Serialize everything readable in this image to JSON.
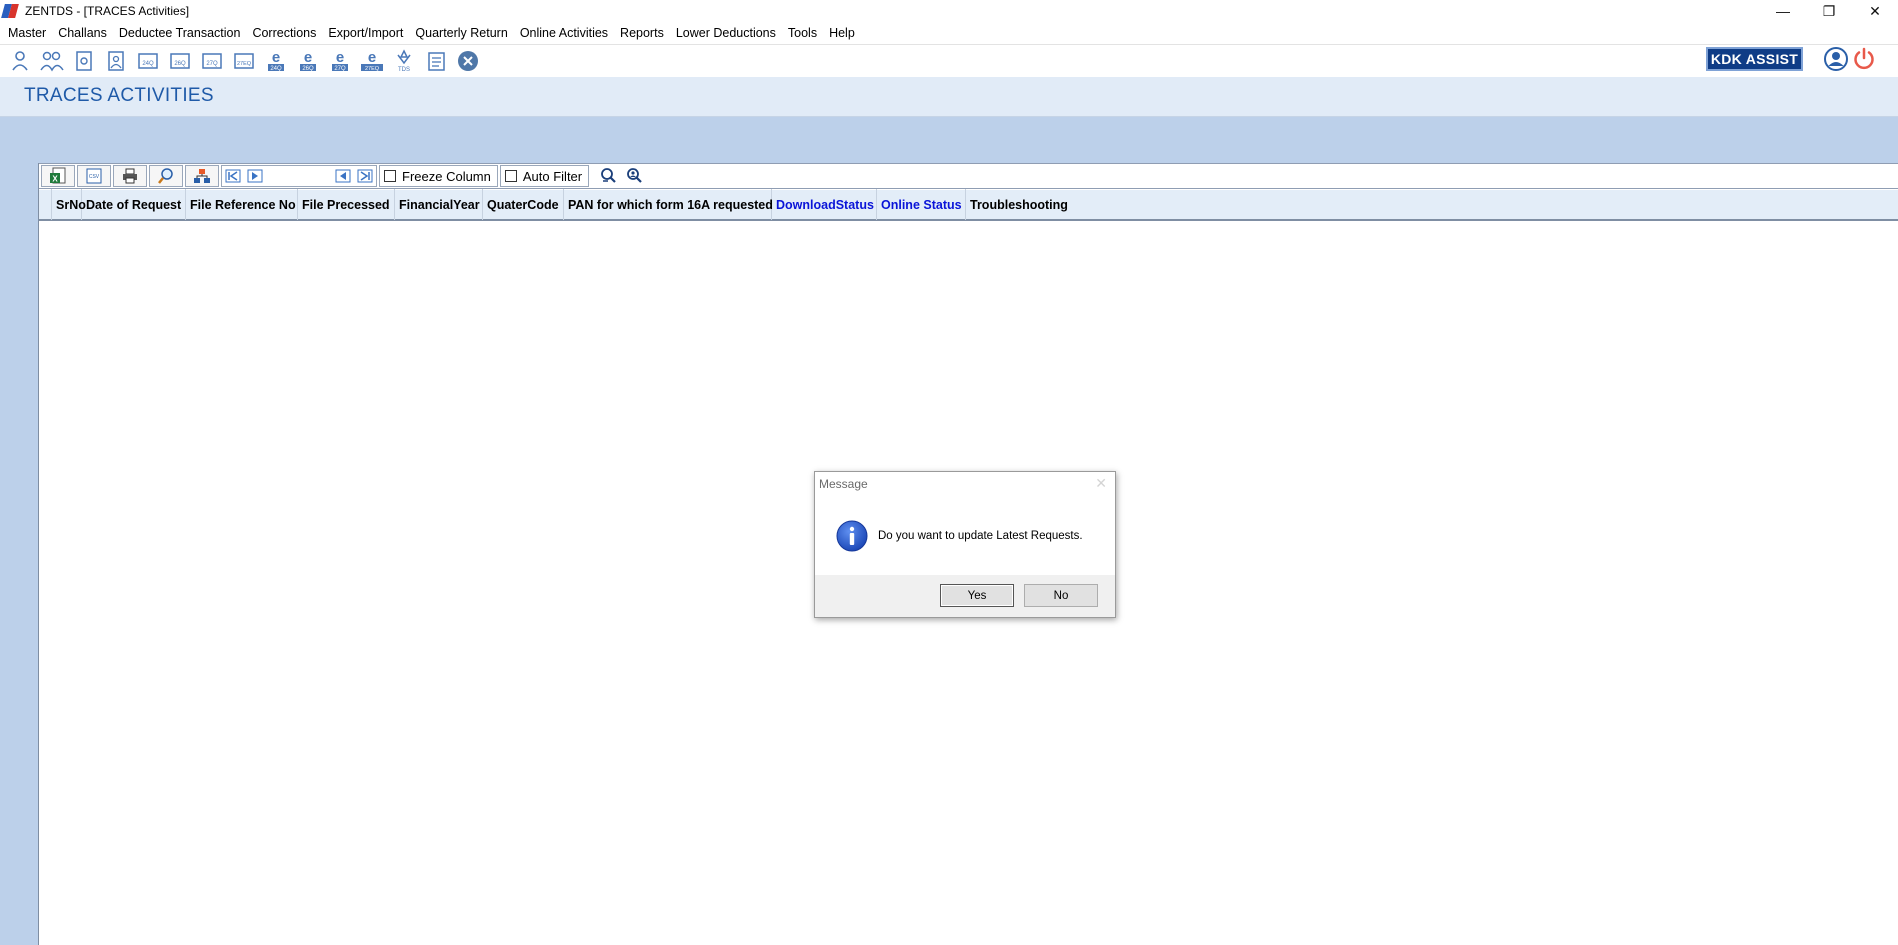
{
  "window": {
    "title": "ZENTDS - [TRACES Activities]",
    "controls": {
      "minimize": "—",
      "restore": "❐",
      "close": "✕"
    }
  },
  "menu": [
    "Master",
    "Challans",
    "Deductee Transaction",
    "Corrections",
    "Export/Import",
    "Quarterly Return",
    "Online Activities",
    "Reports",
    "Lower Deductions",
    "Tools",
    "Help"
  ],
  "toolbar": {
    "icons": [
      "deductor-icon",
      "deductees-icon",
      "form-icon",
      "form-user-icon",
      "form-24q-icon",
      "form-26q-icon",
      "form-27q-icon",
      "form-27eq-icon",
      "e-24-icon",
      "e-26-icon",
      "e-27-icon",
      "e-27e-icon",
      "tds-icon",
      "notes-icon",
      "close-icon"
    ],
    "kdk_assist": "KDK ASSIST"
  },
  "page": {
    "title": "TRACES ACTIVITIES"
  },
  "grid_toolbar": {
    "freeze_column": "Freeze Column",
    "auto_filter": "Auto Filter"
  },
  "columns": [
    "SrNo",
    "Date of Request",
    "File Reference No",
    "File Precessed",
    "FinancialYear",
    "QuaterCode",
    "PAN for which form 16A requested",
    "DownloadStatus",
    "Online Status",
    "Troubleshooting"
  ],
  "colors": {
    "accent": "#1f5aa8",
    "link_column": "#0a14d8",
    "band": "#bcd0ea"
  },
  "dialog": {
    "title": "Message",
    "message": "Do you want to update Latest Requests.",
    "yes": "Yes",
    "no": "No"
  }
}
